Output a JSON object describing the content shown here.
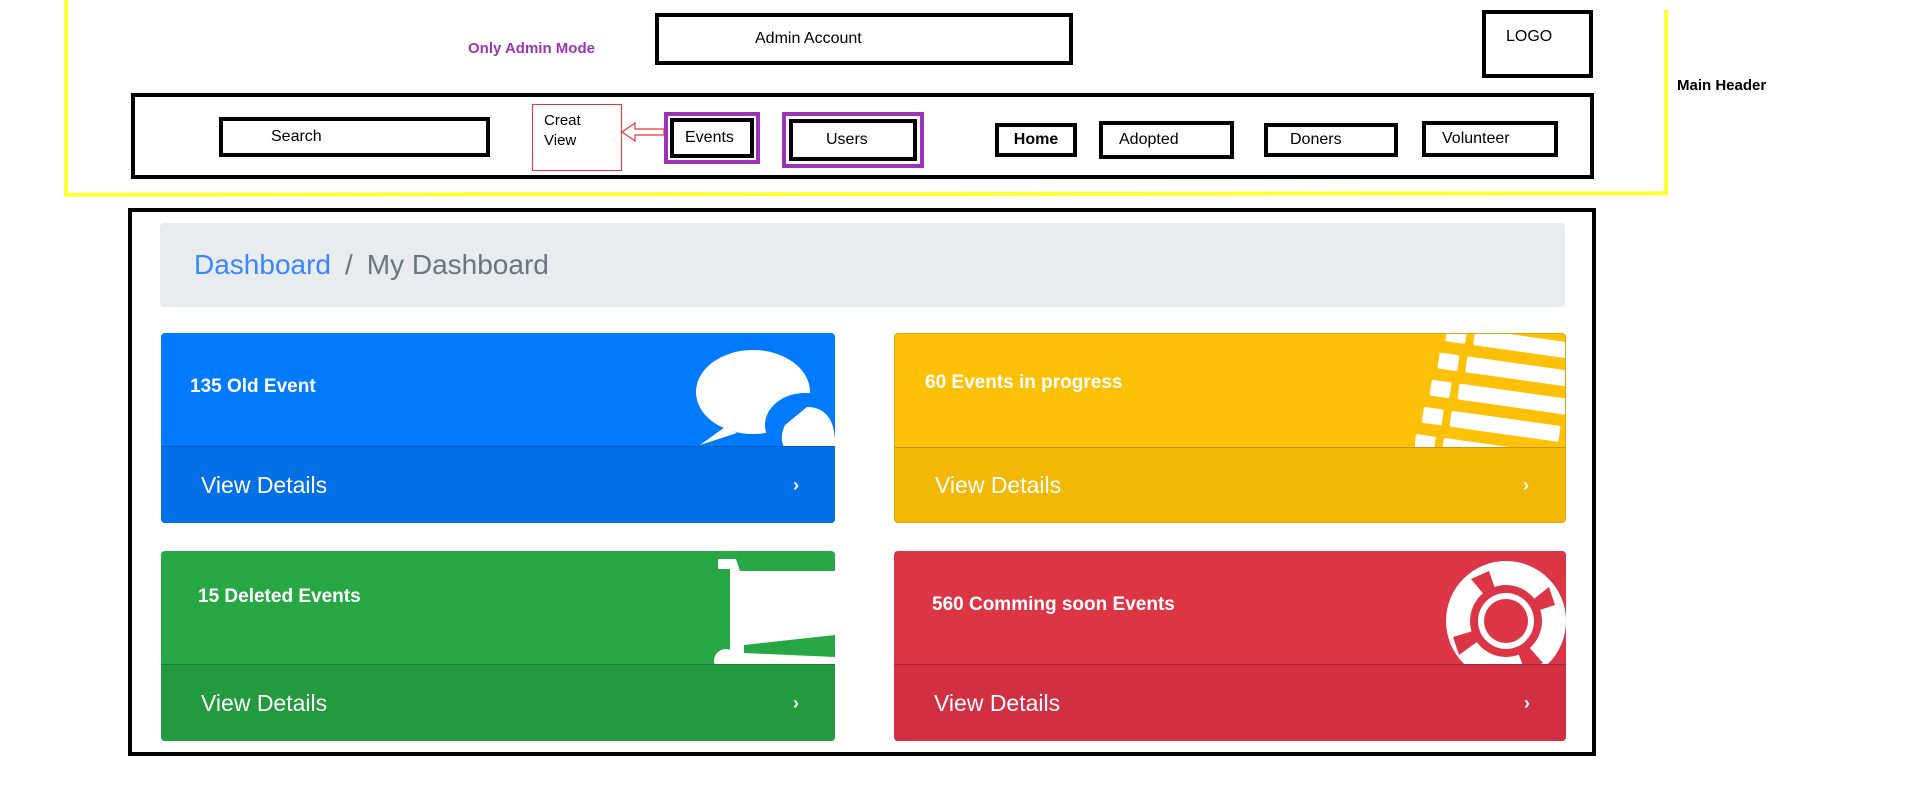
{
  "annotations": {
    "admin_mode": "Only Admin Mode",
    "main_header": "Main Header"
  },
  "header": {
    "admin_account": "Admin Account",
    "logo": "LOGO"
  },
  "nav": {
    "search": "Search",
    "creat_view_line1": "Creat",
    "creat_view_line2": "View",
    "events": "Events",
    "users": "Users",
    "home": "Home",
    "adopted": "Adopted",
    "doners": "Doners",
    "volunteer": "Volunteer"
  },
  "breadcrumb": {
    "root": "Dashboard",
    "separator": "/",
    "current": "My Dashboard"
  },
  "cards": [
    {
      "title": "135 Old Event",
      "link": "View Details",
      "chevron": "›",
      "color": "#007bff",
      "icon": "comments-icon"
    },
    {
      "title": "60 Events in progress",
      "link": "View Details",
      "chevron": "›",
      "color": "#ffc107",
      "icon": "list-icon"
    },
    {
      "title": "15 Deleted Events",
      "link": "View Details",
      "chevron": "›",
      "color": "#28a745",
      "icon": "shopping-cart-icon"
    },
    {
      "title": "560 Comming soon Events",
      "link": "View Details",
      "chevron": "›",
      "color": "#dc3545",
      "icon": "life-ring-icon"
    }
  ]
}
